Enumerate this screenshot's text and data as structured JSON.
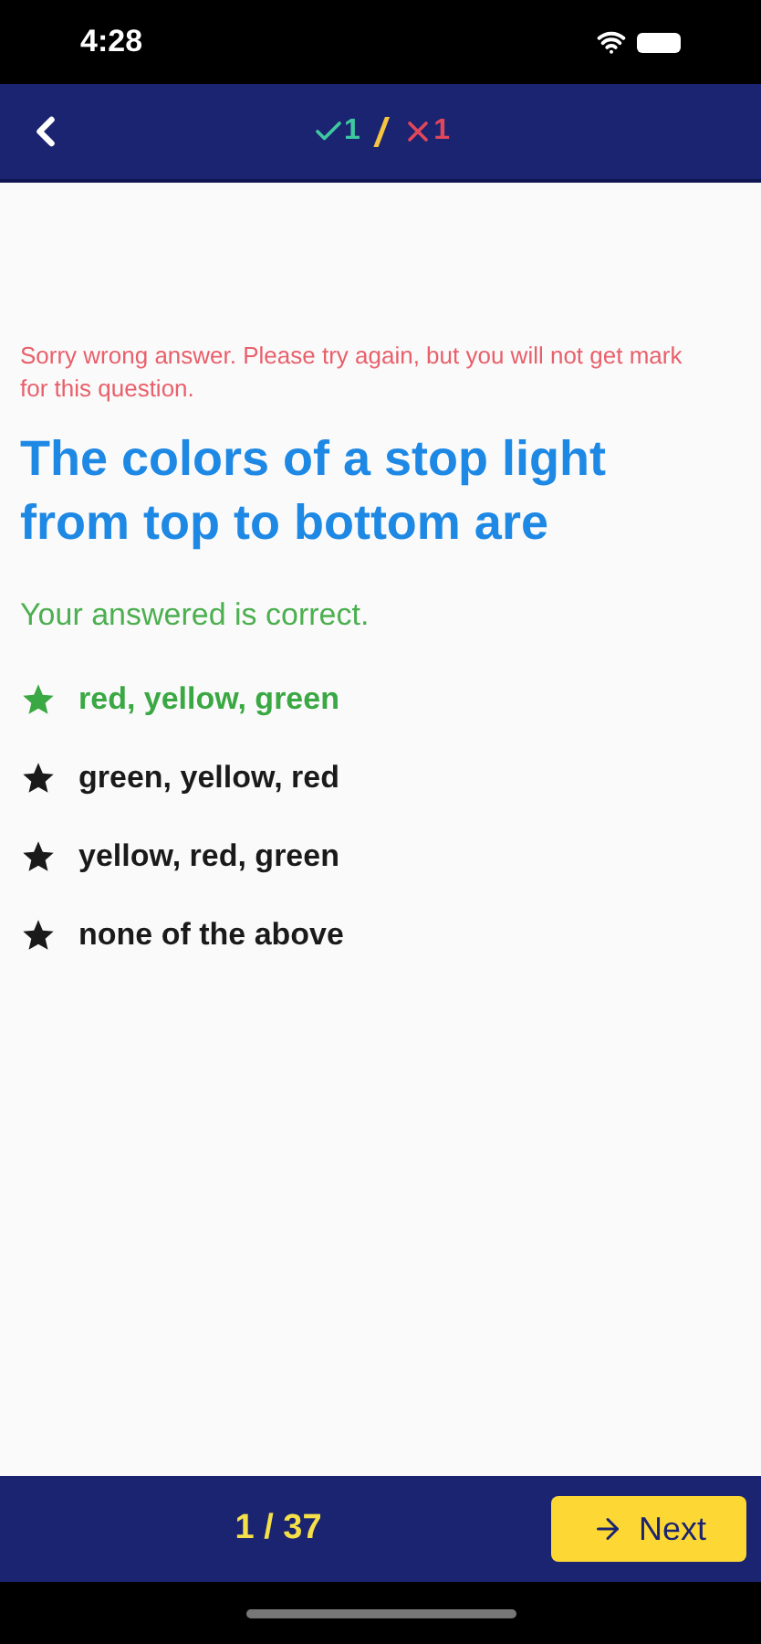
{
  "status_bar": {
    "time": "4:28"
  },
  "header": {
    "correct_count": "1",
    "separator": "/",
    "wrong_count": "1"
  },
  "warning": "Sorry wrong answer. Please try again, but you will not get mark for this question.",
  "question": "The colors of a stop light from top to bottom are",
  "feedback": "Your answered is correct.",
  "options": [
    {
      "text": "red, yellow, green",
      "correct": true
    },
    {
      "text": "green, yellow, red",
      "correct": false
    },
    {
      "text": "yellow, red, green",
      "correct": false
    },
    {
      "text": "none of the above",
      "correct": false
    }
  ],
  "footer": {
    "progress": "1 / 37",
    "next_label": "Next"
  }
}
